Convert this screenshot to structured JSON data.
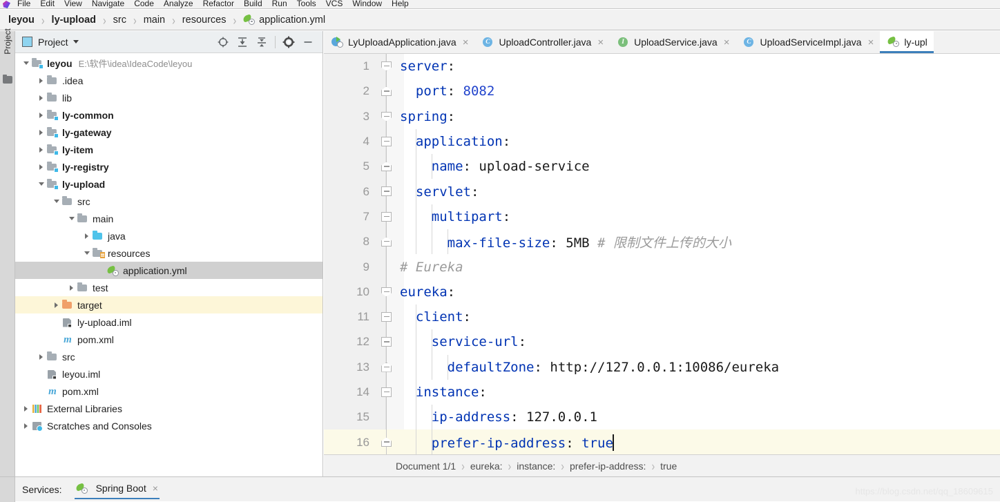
{
  "menubar": {
    "items": [
      "File",
      "Edit",
      "View",
      "Navigate",
      "Code",
      "Analyze",
      "Refactor",
      "Build",
      "Run",
      "Tools",
      "VCS",
      "Window",
      "Help"
    ]
  },
  "navbar": {
    "crumbs": [
      {
        "label": "leyou",
        "bold": true
      },
      {
        "label": "ly-upload",
        "bold": true
      },
      {
        "label": "src",
        "bold": false
      },
      {
        "label": "main",
        "bold": false
      },
      {
        "label": "resources",
        "bold": false
      },
      {
        "label": "application.yml",
        "bold": false,
        "icon": "yml-spring-icon"
      }
    ],
    "separator": "›"
  },
  "tool_stripe": {
    "label": "Project",
    "icon": "folder-icon"
  },
  "project_panel": {
    "title": "Project",
    "toolbar": [
      {
        "name": "locate-icon",
        "tooltip": "Select Opened File"
      },
      {
        "name": "expand-all-icon",
        "tooltip": "Expand All"
      },
      {
        "name": "collapse-all-icon",
        "tooltip": "Collapse All"
      },
      {
        "name": "gear-icon",
        "tooltip": "Settings"
      },
      {
        "name": "minimize-icon",
        "tooltip": "Hide"
      }
    ],
    "tree": [
      {
        "label": "leyou",
        "path": "E:\\软件\\idea\\IdeaCode\\leyou",
        "depth": 0,
        "arrow": "down",
        "icon": "module-folder",
        "bold": true,
        "state": "none"
      },
      {
        "label": ".idea",
        "path": "",
        "depth": 1,
        "arrow": "right",
        "icon": "folder",
        "bold": false,
        "state": "none"
      },
      {
        "label": "lib",
        "path": "",
        "depth": 1,
        "arrow": "right",
        "icon": "folder",
        "bold": false,
        "state": "none"
      },
      {
        "label": "ly-common",
        "path": "",
        "depth": 1,
        "arrow": "right",
        "icon": "module-folder",
        "bold": true,
        "state": "none"
      },
      {
        "label": "ly-gateway",
        "path": "",
        "depth": 1,
        "arrow": "right",
        "icon": "module-folder",
        "bold": true,
        "state": "none"
      },
      {
        "label": "ly-item",
        "path": "",
        "depth": 1,
        "arrow": "right",
        "icon": "module-folder",
        "bold": true,
        "state": "none"
      },
      {
        "label": "ly-registry",
        "path": "",
        "depth": 1,
        "arrow": "right",
        "icon": "module-folder",
        "bold": true,
        "state": "none"
      },
      {
        "label": "ly-upload",
        "path": "",
        "depth": 1,
        "arrow": "down",
        "icon": "module-folder",
        "bold": true,
        "state": "none"
      },
      {
        "label": "src",
        "path": "",
        "depth": 2,
        "arrow": "down",
        "icon": "folder",
        "bold": false,
        "state": "none"
      },
      {
        "label": "main",
        "path": "",
        "depth": 3,
        "arrow": "down",
        "icon": "folder",
        "bold": false,
        "state": "none"
      },
      {
        "label": "java",
        "path": "",
        "depth": 4,
        "arrow": "right",
        "icon": "source-folder",
        "bold": false,
        "state": "none"
      },
      {
        "label": "resources",
        "path": "",
        "depth": 4,
        "arrow": "down",
        "icon": "resource-folder",
        "bold": false,
        "state": "none"
      },
      {
        "label": "application.yml",
        "path": "",
        "depth": 5,
        "arrow": "none",
        "icon": "yml-spring",
        "bold": false,
        "state": "selected"
      },
      {
        "label": "test",
        "path": "",
        "depth": 3,
        "arrow": "right",
        "icon": "folder",
        "bold": false,
        "state": "none"
      },
      {
        "label": "target",
        "path": "",
        "depth": 2,
        "arrow": "right",
        "icon": "excluded-folder",
        "bold": false,
        "state": "highlight"
      },
      {
        "label": "ly-upload.iml",
        "path": "",
        "depth": 2,
        "arrow": "none",
        "icon": "iml",
        "bold": false,
        "state": "none"
      },
      {
        "label": "pom.xml",
        "path": "",
        "depth": 2,
        "arrow": "none",
        "icon": "maven",
        "bold": false,
        "state": "none"
      },
      {
        "label": "src",
        "path": "",
        "depth": 1,
        "arrow": "right",
        "icon": "folder",
        "bold": false,
        "state": "none"
      },
      {
        "label": "leyou.iml",
        "path": "",
        "depth": 1,
        "arrow": "none",
        "icon": "iml",
        "bold": false,
        "state": "none"
      },
      {
        "label": "pom.xml",
        "path": "",
        "depth": 1,
        "arrow": "none",
        "icon": "maven",
        "bold": false,
        "state": "none"
      },
      {
        "label": "External Libraries",
        "path": "",
        "depth": 0,
        "arrow": "right",
        "icon": "library",
        "bold": false,
        "state": "none"
      },
      {
        "label": "Scratches and Consoles",
        "path": "",
        "depth": 0,
        "arrow": "right",
        "icon": "scratch",
        "bold": false,
        "state": "none"
      }
    ]
  },
  "editor": {
    "tabs": [
      {
        "label": "LyUploadApplication.java",
        "icon": "spring-boot-run-icon",
        "active": false,
        "closable": true
      },
      {
        "label": "UploadController.java",
        "icon": "java-class-icon",
        "glyph": "C",
        "active": false,
        "closable": true
      },
      {
        "label": "UploadService.java",
        "icon": "java-interface-icon",
        "glyph": "I",
        "active": false,
        "closable": true
      },
      {
        "label": "UploadServiceImpl.java",
        "icon": "java-class-icon",
        "glyph": "C",
        "active": false,
        "closable": true
      },
      {
        "label": "ly-upl",
        "icon": "yml-spring-icon",
        "active": true,
        "closable": false
      }
    ],
    "close_glyph": "×",
    "lines": [
      {
        "num": 1,
        "fold": "top",
        "indent": 0,
        "segments": [
          {
            "t": "server",
            "c": "k"
          },
          {
            "t": ":",
            "c": "v"
          }
        ]
      },
      {
        "num": 2,
        "fold": "bot",
        "indent": 0,
        "segments": [
          {
            "t": "  ",
            "c": "v"
          },
          {
            "t": "port",
            "c": "k"
          },
          {
            "t": ": ",
            "c": "v"
          },
          {
            "t": "8082",
            "c": "num"
          }
        ]
      },
      {
        "num": 3,
        "fold": "top",
        "indent": 0,
        "segments": [
          {
            "t": "spring",
            "c": "k"
          },
          {
            "t": ":",
            "c": "v"
          }
        ]
      },
      {
        "num": 4,
        "fold": "mid",
        "indent": 1,
        "segments": [
          {
            "t": "  ",
            "c": "v"
          },
          {
            "t": "application",
            "c": "k"
          },
          {
            "t": ":",
            "c": "v"
          }
        ]
      },
      {
        "num": 5,
        "fold": "bot",
        "indent": 2,
        "segments": [
          {
            "t": "    ",
            "c": "v"
          },
          {
            "t": "name",
            "c": "k"
          },
          {
            "t": ": ",
            "c": "v"
          },
          {
            "t": "upload-service",
            "c": "v"
          }
        ]
      },
      {
        "num": 6,
        "fold": "mid",
        "indent": 1,
        "segments": [
          {
            "t": "  ",
            "c": "v"
          },
          {
            "t": "servlet",
            "c": "k"
          },
          {
            "t": ":",
            "c": "v"
          }
        ]
      },
      {
        "num": 7,
        "fold": "mid",
        "indent": 2,
        "segments": [
          {
            "t": "    ",
            "c": "v"
          },
          {
            "t": "multipart",
            "c": "k"
          },
          {
            "t": ":",
            "c": "v"
          }
        ]
      },
      {
        "num": 8,
        "fold": "bot",
        "indent": 3,
        "segments": [
          {
            "t": "      ",
            "c": "v"
          },
          {
            "t": "max-file-size",
            "c": "k"
          },
          {
            "t": ": ",
            "c": "v"
          },
          {
            "t": "5MB",
            "c": "v"
          },
          {
            "t": " # 限制文件上传的大小",
            "c": "cm"
          }
        ]
      },
      {
        "num": 9,
        "fold": "none",
        "indent": 0,
        "segments": [
          {
            "t": "# Eureka",
            "c": "cm"
          }
        ]
      },
      {
        "num": 10,
        "fold": "top",
        "indent": 0,
        "segments": [
          {
            "t": "eureka",
            "c": "k"
          },
          {
            "t": ":",
            "c": "v"
          }
        ]
      },
      {
        "num": 11,
        "fold": "mid",
        "indent": 1,
        "segments": [
          {
            "t": "  ",
            "c": "v"
          },
          {
            "t": "client",
            "c": "k"
          },
          {
            "t": ":",
            "c": "v"
          }
        ]
      },
      {
        "num": 12,
        "fold": "mid",
        "indent": 2,
        "segments": [
          {
            "t": "    ",
            "c": "v"
          },
          {
            "t": "service-url",
            "c": "k"
          },
          {
            "t": ":",
            "c": "v"
          }
        ]
      },
      {
        "num": 13,
        "fold": "bot",
        "indent": 3,
        "segments": [
          {
            "t": "      ",
            "c": "v"
          },
          {
            "t": "defaultZone",
            "c": "k"
          },
          {
            "t": ": ",
            "c": "v"
          },
          {
            "t": "http://127.0.0.1:10086/eureka",
            "c": "v"
          }
        ]
      },
      {
        "num": 14,
        "fold": "mid",
        "indent": 1,
        "segments": [
          {
            "t": "  ",
            "c": "v"
          },
          {
            "t": "instance",
            "c": "k"
          },
          {
            "t": ":",
            "c": "v"
          }
        ]
      },
      {
        "num": 15,
        "fold": "none",
        "indent": 2,
        "segments": [
          {
            "t": "    ",
            "c": "v"
          },
          {
            "t": "ip-address",
            "c": "k"
          },
          {
            "t": ": ",
            "c": "v"
          },
          {
            "t": "127.0.0.1",
            "c": "v"
          }
        ]
      },
      {
        "num": 16,
        "fold": "bot",
        "indent": 2,
        "current": true,
        "caret": true,
        "segments": [
          {
            "t": "    ",
            "c": "v"
          },
          {
            "t": "prefer-ip-address",
            "c": "k"
          },
          {
            "t": ": ",
            "c": "v"
          },
          {
            "t": "true",
            "c": "bool"
          }
        ]
      }
    ],
    "breadcrumb": [
      "Document 1/1",
      "eureka:",
      "instance:",
      "prefer-ip-address:",
      "true"
    ],
    "breadcrumb_sep": "›"
  },
  "status_bar": {
    "services_label": "Services:",
    "tab_label": "Spring Boot",
    "tab_close": "×",
    "watermark": "https://blog.csdn.net/qq_18609615"
  },
  "colors": {
    "accent_blue": "#3c7fbb",
    "key_blue": "#0033b3",
    "comment_gray": "#9b9b9b",
    "selection_gray": "#d0d0d0",
    "current_line": "#fcfae8"
  }
}
